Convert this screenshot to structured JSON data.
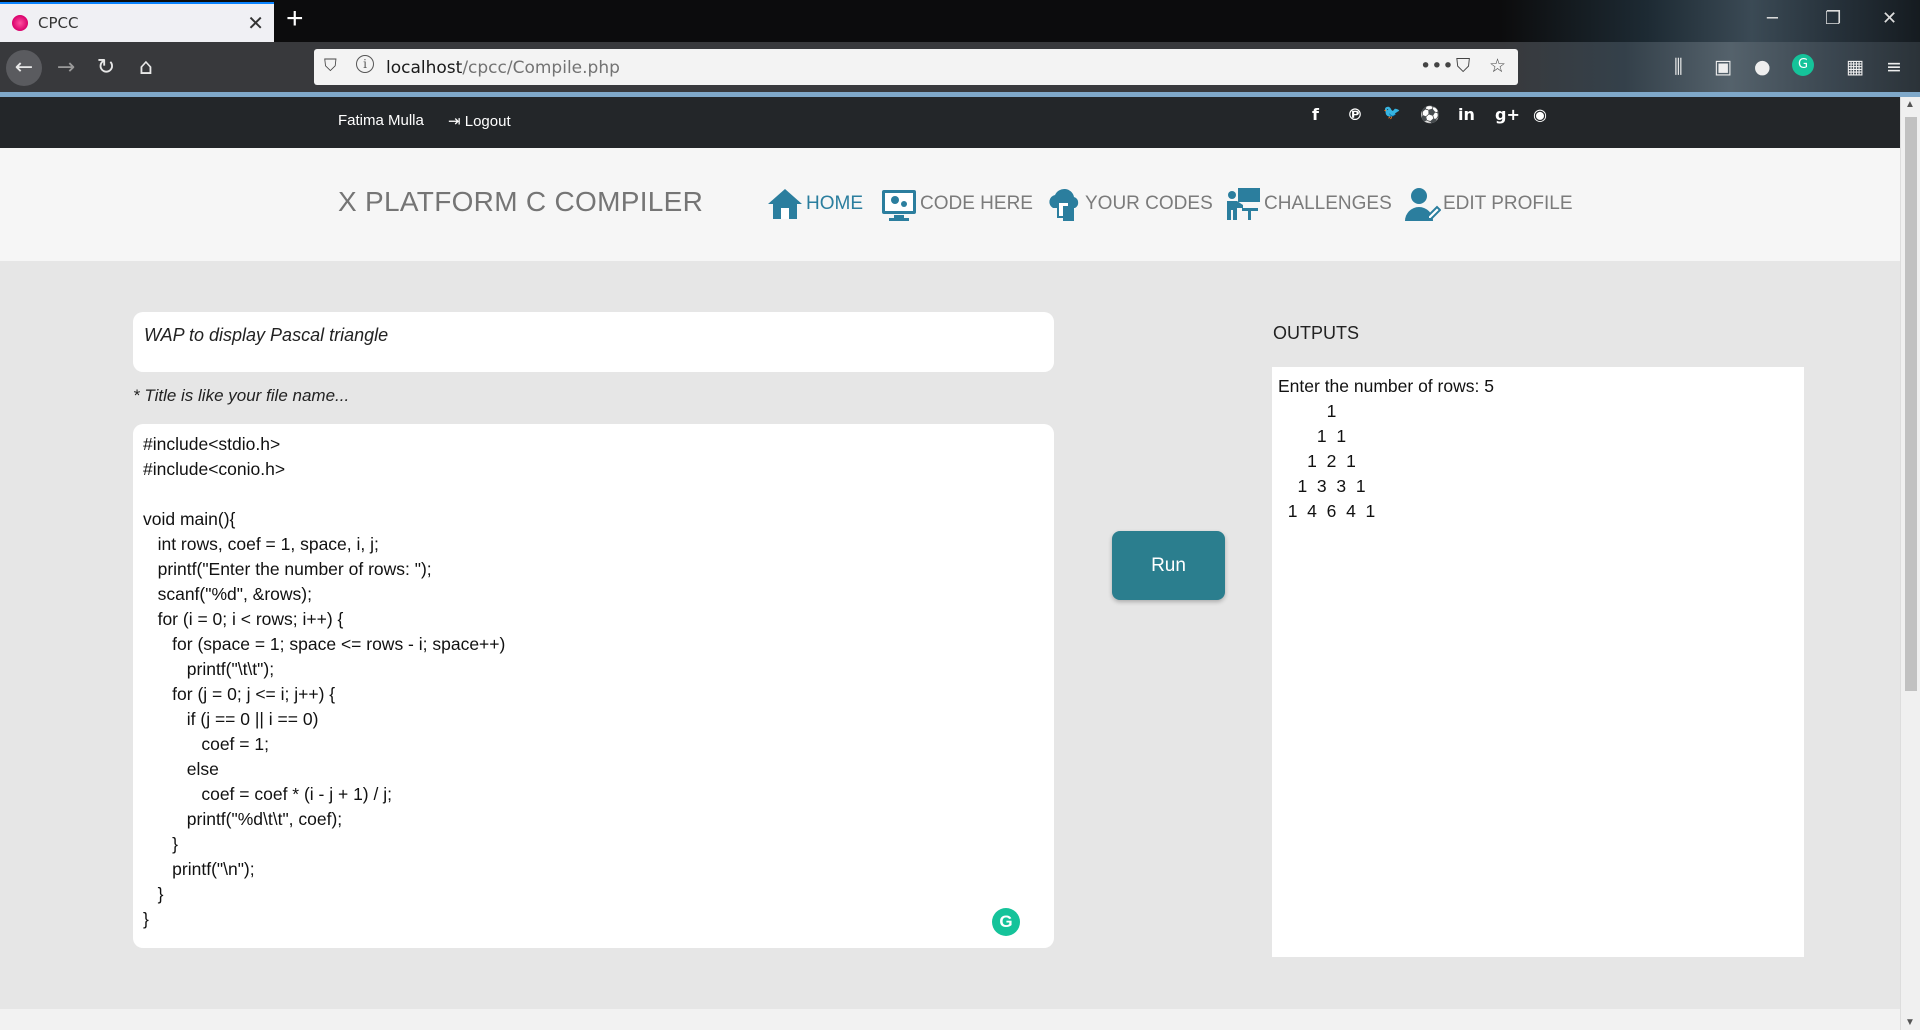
{
  "browser": {
    "tab_title": "CPCC",
    "tab_close": "✕",
    "new_tab": "+",
    "url_host": "localhost",
    "url_path": "/cpcc/Compile.php",
    "window_controls": [
      "─",
      "❐",
      "✕"
    ],
    "url_actions": [
      "•••",
      "⛉",
      "☆"
    ]
  },
  "topbar": {
    "user_name": "Fatima Mulla",
    "logout_label": "Logout",
    "social": [
      "f",
      "℗",
      "🐦",
      "⚽",
      "in",
      "g+",
      "◉"
    ]
  },
  "header": {
    "brand": "X PLATFORM C COMPILER",
    "menu": [
      {
        "label": "HOME",
        "icon": "home-icon",
        "active": true
      },
      {
        "label": "CODE HERE",
        "icon": "monitor-gear-icon"
      },
      {
        "label": "YOUR CODES",
        "icon": "cloud-files-icon"
      },
      {
        "label": "CHALLENGES",
        "icon": "classroom-icon"
      },
      {
        "label": "EDIT PROFILE",
        "icon": "user-edit-icon"
      }
    ]
  },
  "editor": {
    "title_value": "WAP to display Pascal triangle",
    "title_hint": "* Title is like your file name...",
    "code": "#include<stdio.h>\n#include<conio.h>\n\nvoid main(){\n   int rows, coef = 1, space, i, j;\n   printf(\"Enter the number of rows: \");\n   scanf(\"%d\", &rows);\n   for (i = 0; i < rows; i++) {\n      for (space = 1; space <= rows - i; space++)\n         printf(\"\\t\\t\");\n      for (j = 0; j <= i; j++) {\n         if (j == 0 || i == 0)\n            coef = 1;\n         else\n            coef = coef * (i - j + 1) / j;\n         printf(\"%d\\t\\t\", coef);\n      }\n      printf(\"\\n\");\n   }\n}",
    "run_label": "Run"
  },
  "outputs": {
    "title": "OUTPUTS",
    "text": "Enter the number of rows: 5\n          1\n        1  1\n      1  2  1\n    1  3  3  1\n  1  4  6  4  1"
  },
  "colors": {
    "accent": "#2b7e9e",
    "run_button": "#2b7e8e",
    "topbar": "#232629",
    "grammarly": "#15c39a"
  }
}
